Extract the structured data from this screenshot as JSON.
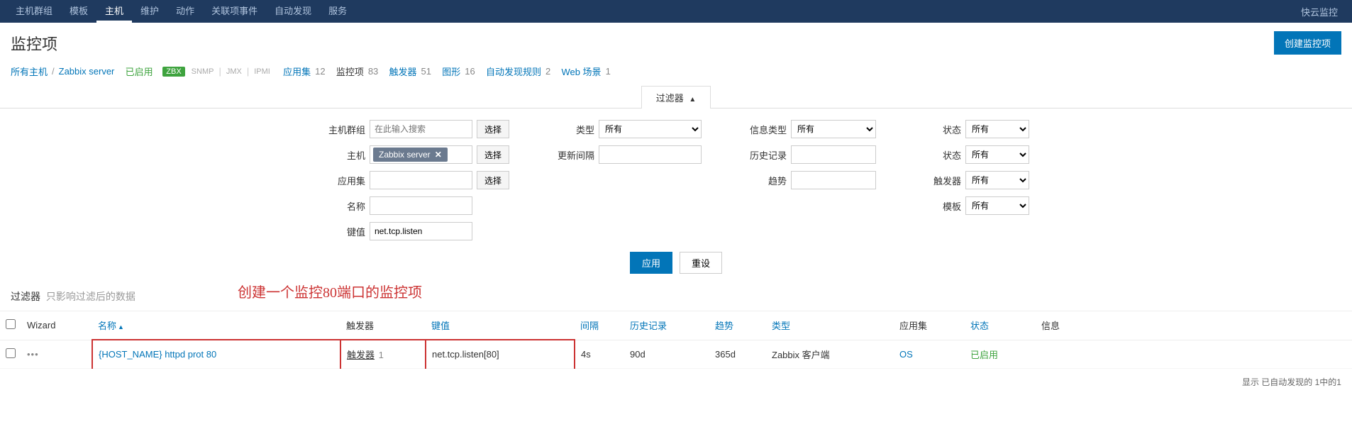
{
  "topnav": {
    "items": [
      "主机群组",
      "模板",
      "主机",
      "维护",
      "动作",
      "关联项事件",
      "自动发现",
      "服务"
    ],
    "active_index": 2,
    "right_label": "快云监控"
  },
  "page": {
    "title": "监控项",
    "create_btn": "创建监控项"
  },
  "breadcrumb": {
    "all_hosts": "所有主机",
    "host": "Zabbix server",
    "status": "已启用",
    "zbx": "ZBX",
    "snmp": "SNMP",
    "jmx": "JMX",
    "ipmi": "IPMI",
    "links": [
      {
        "label": "应用集",
        "count": "12"
      },
      {
        "label": "监控项",
        "count": "83",
        "active": true
      },
      {
        "label": "触发器",
        "count": "51"
      },
      {
        "label": "图形",
        "count": "16"
      },
      {
        "label": "自动发现规则",
        "count": "2"
      },
      {
        "label": "Web 场景",
        "count": "1"
      }
    ]
  },
  "filter": {
    "tab_label": "过滤器",
    "labels": {
      "hostgroup": "主机群组",
      "host": "主机",
      "appset": "应用集",
      "name": "名称",
      "key": "键值",
      "type": "类型",
      "interval": "更新间隔",
      "infotype": "信息类型",
      "history": "历史记录",
      "trend": "趋势",
      "state": "状态",
      "status": "状态",
      "triggers": "触发器",
      "template": "模板"
    },
    "placeholder_search": "在此输入搜索",
    "host_chip": "Zabbix server",
    "key_value": "net.tcp.listen",
    "select_btn": "选择",
    "option_all": "所有",
    "apply_btn": "应用",
    "reset_btn": "重设",
    "hint_label": "过滤器",
    "hint_sub": "只影响过滤后的数据",
    "annotation": "创建一个监控80端口的监控项"
  },
  "table": {
    "headers": {
      "wizard": "Wizard",
      "name": "名称",
      "trigger": "触发器",
      "key": "键值",
      "interval": "间隔",
      "history": "历史记录",
      "trend": "趋势",
      "type": "类型",
      "appset": "应用集",
      "status": "状态",
      "info": "信息"
    },
    "row": {
      "name": "{HOST_NAME} httpd prot 80",
      "trigger_label": "触发器",
      "trigger_count": "1",
      "key": "net.tcp.listen[80]",
      "interval": "4s",
      "history": "90d",
      "trend": "365d",
      "type": "Zabbix 客户端",
      "appset": "OS",
      "status": "已启用"
    },
    "footer": "显示 已自动发现的 1中的1"
  }
}
